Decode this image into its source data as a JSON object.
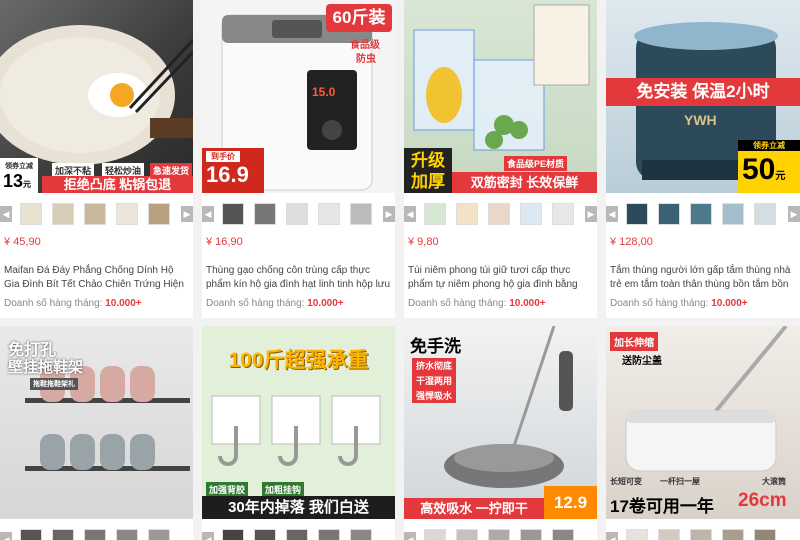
{
  "products": [
    {
      "price": "¥ 45,90",
      "title": "Maifan Đá Đáy Phẳng Chống Dính Hộ Gia Đình Bít Tết Chảo Chiên Trứng Hiện Vật",
      "sales_label": "Doanh số hàng tháng:",
      "sales_value": "10.000+",
      "image": {
        "tag_top": "领券立减",
        "tag_num": "13",
        "tag_unit": "元",
        "line1a": "加深不粘",
        "line1b": "轻松炒油",
        "line1c": "急速发货",
        "line2": "拒绝凸底 粘锅包退"
      }
    },
    {
      "price": "¥ 16,90",
      "title": "Thùng gạo chống côn trùng cấp thực phẩm kín hộ gia đình hạt linh tinh hộp lưu",
      "sales_label": "Doanh số hàng tháng:",
      "sales_value": "10.000+",
      "image": {
        "badge": "60斤装",
        "sub1": "食品级",
        "sub2": "防虫",
        "display": "15.0",
        "tag_top": "到手价",
        "price": "16.9"
      }
    },
    {
      "price": "¥ 9,80",
      "title": "Túi niêm phong túi giữ tươi cấp thực phẩm tự niêm phong hộ gia đình bằng nhựa dày",
      "sales_label": "Doanh số hàng tháng:",
      "sales_value": "10.000+",
      "image": {
        "box_text": "食品级PE材质",
        "big1": "升级",
        "big2": "加厚",
        "slogan": "双筋密封 长效保鲜"
      }
    },
    {
      "price": "¥ 128,00",
      "title": "Tắm thùng người lớn gấp tắm thùng nhà trẻ em tắm toàn thân thùng bồn tắm bồn",
      "sales_label": "Doanh số hàng tháng:",
      "sales_value": "10.000+",
      "image": {
        "headline": "免安装 保温2小时",
        "brand": "YWH",
        "tag_top": "领券立减",
        "tag_num": "50",
        "tag_unit": "元"
      }
    },
    {
      "image": {
        "headline1": "免打孔",
        "headline2": "壁挂拖鞋架",
        "small": "拖鞋拖鞋架礼"
      }
    },
    {
      "image": {
        "headline": "100斤超强承重",
        "tag1": "加强背胶",
        "tag2": "加粗挂钩",
        "bottom": "30年内掉落 我们白送"
      }
    },
    {
      "image": {
        "headline": "免手洗",
        "b1": "挤水彻底",
        "b2": "干湿两用",
        "b3": "强悍吸水",
        "bottom": "高效吸水 一拧即干",
        "price": "12.9"
      }
    },
    {
      "image": {
        "headline1": "加长伸缩",
        "headline2": "送防尘盖",
        "small1": "长短可变",
        "small2": "一杆扫一屋",
        "small3": "大滚筒",
        "bottom": "17卷可用一年",
        "size": "26cm"
      }
    }
  ],
  "colors": {
    "price_red": "#e4393c",
    "page_bg": "#f2f2f2"
  }
}
